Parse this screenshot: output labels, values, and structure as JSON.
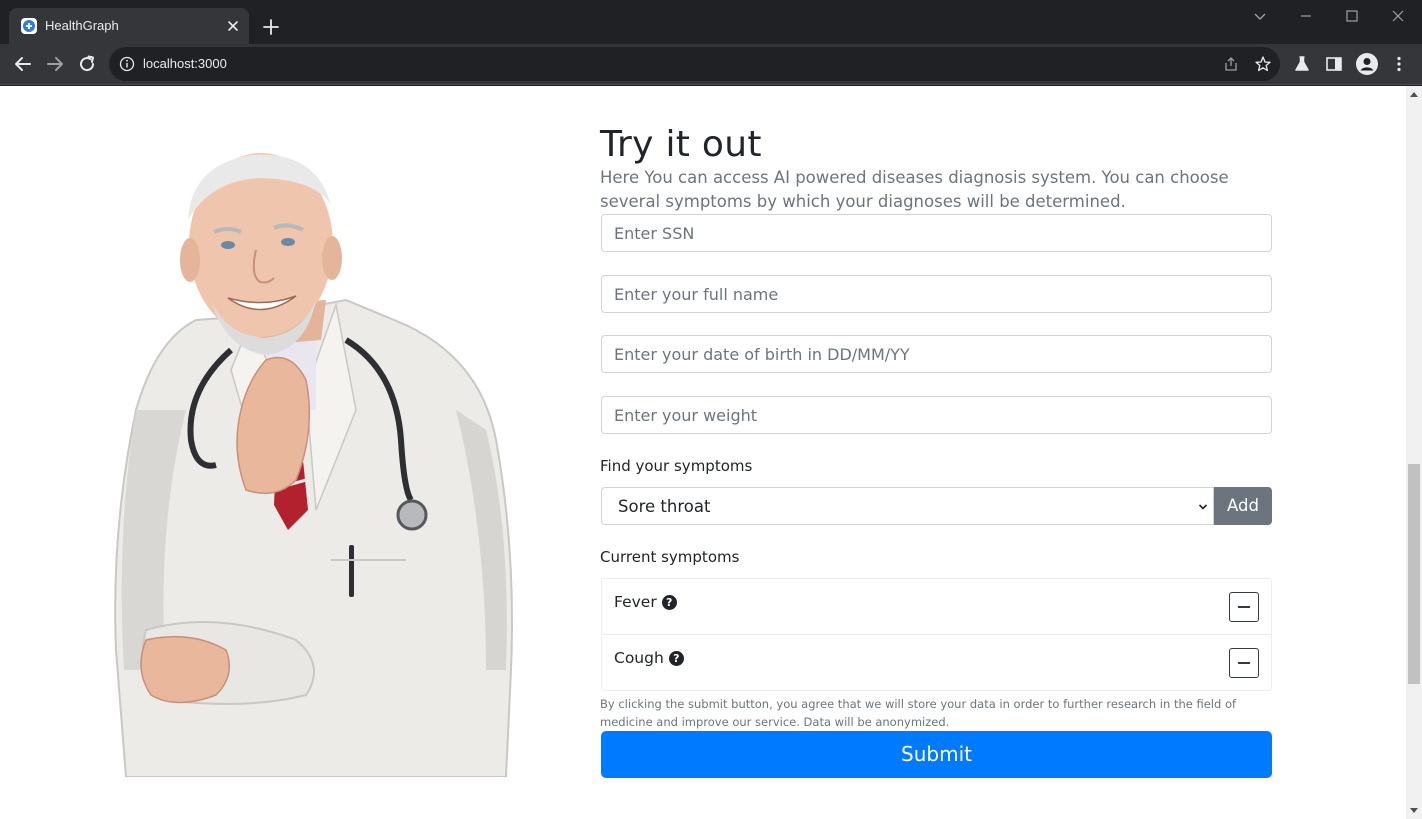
{
  "browser": {
    "tab_title": "HealthGraph",
    "url": "localhost:3000"
  },
  "page": {
    "title": "Try it out",
    "description": "Here You can access AI powered diseases diagnosis system. You can choose several symptoms by which your diagnoses will be determined.",
    "fields": {
      "ssn_placeholder": "Enter SSN",
      "name_placeholder": "Enter your full name",
      "dob_placeholder": "Enter your date of birth in DD/MM/YY",
      "weight_placeholder": "Enter your weight"
    },
    "find_label": "Find your symptoms",
    "selected_symptom": "Sore throat",
    "add_label": "Add",
    "current_label": "Current symptoms",
    "symptoms": [
      "Fever",
      "Cough"
    ],
    "disclaimer": "By clicking the submit button, you agree that we will store your data in order to further research in the field of medicine and improve our service. Data will be anonymized.",
    "submit_label": "Submit"
  },
  "colors": {
    "primary": "#007bff",
    "secondary": "#6c757d",
    "text": "#212529"
  }
}
